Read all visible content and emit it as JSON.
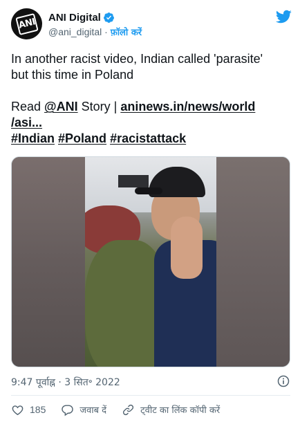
{
  "account": {
    "display_name": "ANI Digital",
    "handle": "@ani_digital",
    "separator": " · ",
    "follow_label": "फ़ॉलो करें",
    "avatar_text": "ANI"
  },
  "tweet": {
    "line1": "In another racist video, Indian called 'parasite'",
    "line2": "but this time in Poland",
    "read_prefix": "Read ",
    "mention": "@ANI",
    "story_text": " Story | ",
    "link_part1": "aninews.in/news/world",
    "link_part2": "/asi...",
    "hashtag1": "#Indian",
    "hashtag2": "#Poland",
    "hashtag3": "#racistattack"
  },
  "meta": {
    "timestamp": "9:47 पूर्वाह्न · 3 सित॰ 2022"
  },
  "actions": {
    "like_count": "185",
    "reply_label": "जवाब दें",
    "copy_link_label": "ट्वीट का लिंक कॉपी करें"
  },
  "colors": {
    "brand_blue": "#1d9bf0",
    "text_primary": "#0f1419",
    "text_secondary": "#536471"
  },
  "icons": {
    "verified": "verified-badge-icon",
    "twitter": "twitter-bird-icon",
    "info": "info-icon",
    "like": "heart-icon",
    "reply": "speech-bubble-icon",
    "copy_link": "link-icon"
  }
}
